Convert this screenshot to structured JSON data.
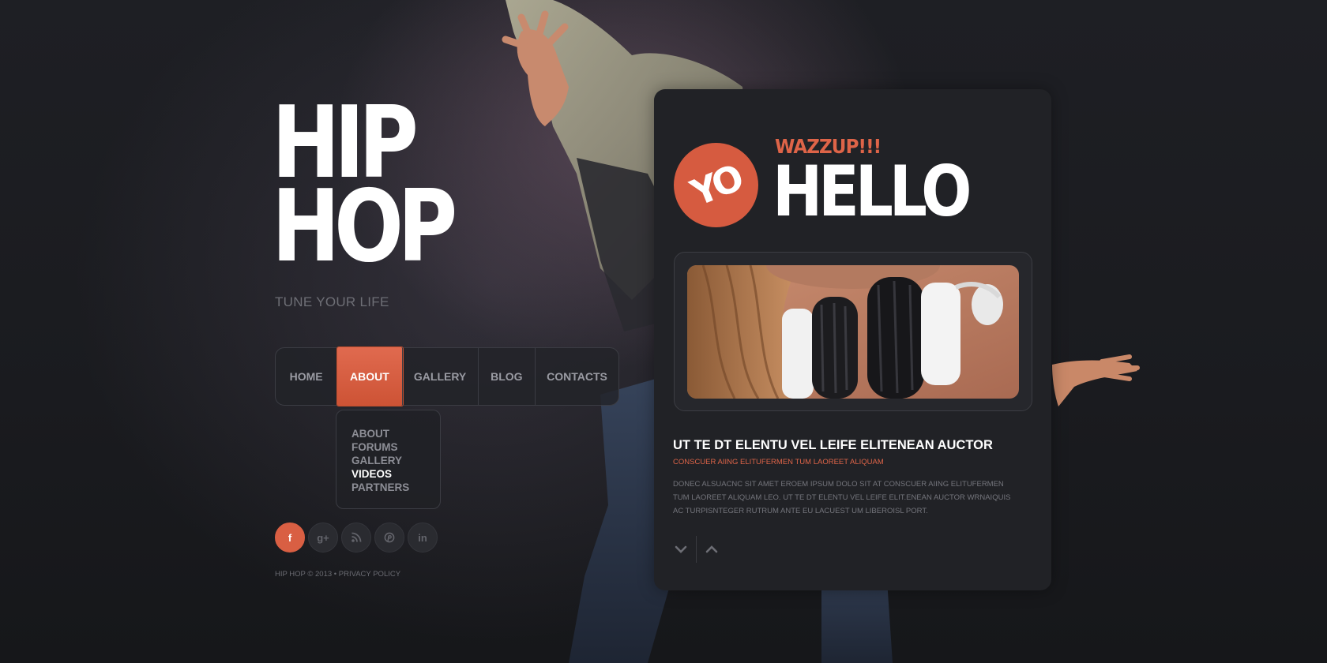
{
  "brand": {
    "logo_line1": "HIP",
    "logo_line2": "HOP",
    "tagline": "TUNE YOUR LIFE"
  },
  "nav": {
    "items": [
      {
        "label": "HOME"
      },
      {
        "label": "ABOUT",
        "active": true
      },
      {
        "label": "GALLERY"
      },
      {
        "label": "BLOG"
      },
      {
        "label": "CONTACTS"
      }
    ],
    "submenu": [
      {
        "label": "ABOUT"
      },
      {
        "label": "FORUMS"
      },
      {
        "label": "GALLERY"
      },
      {
        "label": "VIDEOS",
        "current": true
      },
      {
        "label": "PARTNERS"
      }
    ]
  },
  "social": {
    "facebook": "f",
    "google_plus": "g+",
    "rss": "rss-icon",
    "pinterest": "pinterest-icon",
    "linkedin": "in"
  },
  "footer": {
    "copyright": "HIP HOP © 2013 •",
    "privacy": "PRIVACY POLICY"
  },
  "panel": {
    "badge": "YO",
    "kicker": "WAZZUP!!!",
    "headline": "HELLO",
    "post_title": "UT TE DT ELENTU VEL LEIFE ELITENEAN AUCTOR",
    "post_subtitle": "CONSCUER AIING ELITUFERMEN TUM LAOREET ALIQUAM",
    "post_body": "DONEC ALSUACNC SIT AMET EROEM IPSUM DOLO SIT AT CONSCUER AIING ELITUFERMEN TUM LAOREET ALIQUAM LEO. UT TE DT ELENTU VEL LEIFE ELIT.ENEAN AUCTOR WRNAIQUIS AC TURPISNTEGER RUTRUM ANTE EU LACUEST UM LIBEROISL PORT."
  },
  "colors": {
    "accent": "#d95f43",
    "panel_bg": "#212226",
    "page_bg": "#17181c"
  }
}
